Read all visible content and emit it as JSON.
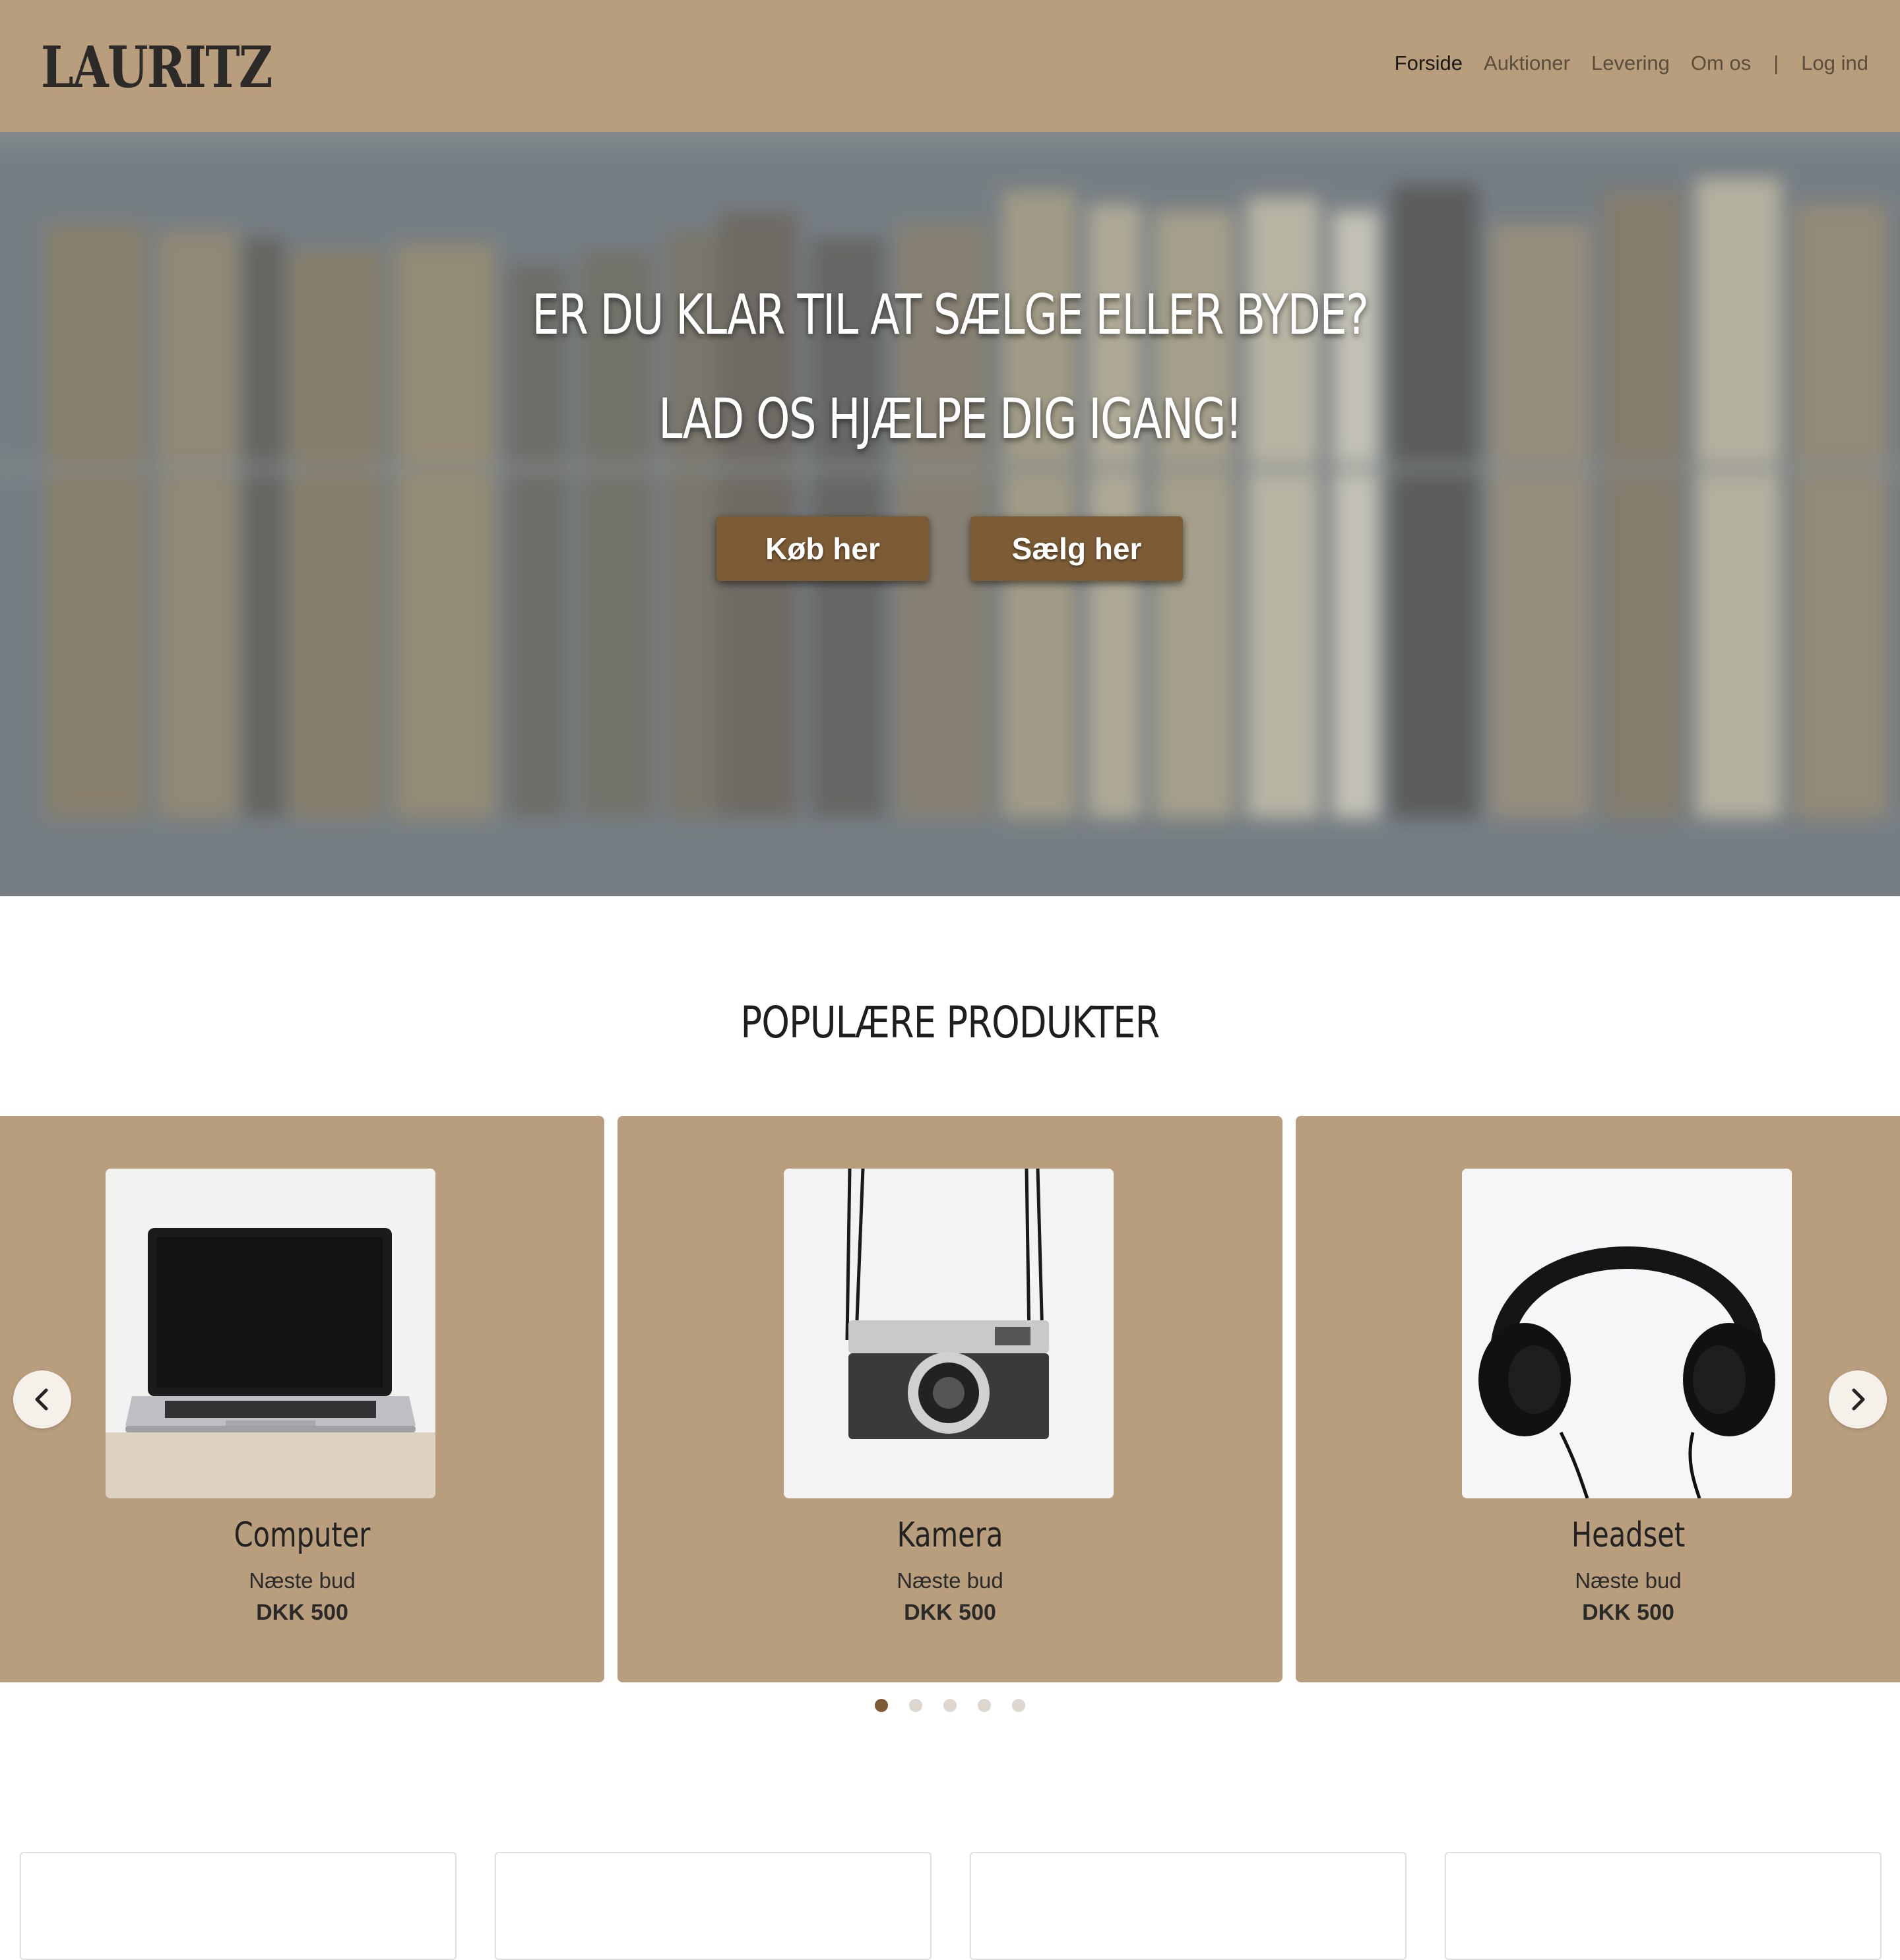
{
  "header": {
    "logo": "LAURITZ",
    "nav": [
      "Forside",
      "Auktioner",
      "Levering",
      "Om os"
    ],
    "separator": "|",
    "login": "Log ind",
    "accent": "#b89e7c"
  },
  "hero": {
    "line1": "ER DU KLAR TIL AT SÆLGE ELLER BYDE?",
    "line2": "LAD OS HJÆLPE DIG IGANG!",
    "buy_label": "Køb her",
    "sell_label": "Sælg her",
    "button_color": "#7d5c35"
  },
  "popular": {
    "title": "POPULÆRE PRODUKTER",
    "products": [
      {
        "name": "Computer",
        "bid_label": "Næste bud",
        "price": "DKK 500",
        "icon": "laptop-image"
      },
      {
        "name": "Kamera",
        "bid_label": "Næste bud",
        "price": "DKK 500",
        "icon": "camera-image"
      },
      {
        "name": "Headset",
        "bid_label": "Næste bud",
        "price": "DKK 500",
        "icon": "headphones-image"
      }
    ],
    "carousel_pages": 5,
    "active_page": 1
  }
}
